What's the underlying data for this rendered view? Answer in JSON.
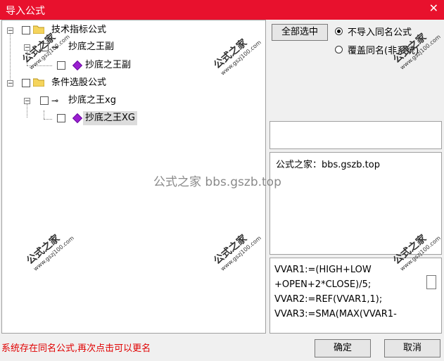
{
  "window": {
    "title": "导入公式",
    "close_label": "✕"
  },
  "tree": {
    "nodes": [
      {
        "label": "技术指标公式",
        "kind": "folder"
      },
      {
        "label": "抄底之王副",
        "kind": "key"
      },
      {
        "label": "抄底之王副",
        "kind": "gem"
      },
      {
        "label": "条件选股公式",
        "kind": "folder"
      },
      {
        "label": "抄底之王xg",
        "kind": "key"
      },
      {
        "label": "抄底之王XG",
        "kind": "gem",
        "selected": true
      }
    ]
  },
  "right": {
    "select_all": "全部选中",
    "radio_options": [
      {
        "label": "不导入同名公式",
        "checked": true
      },
      {
        "label": "覆盖同名(非系统)",
        "checked": false
      }
    ],
    "description": "公式之家：bbs.gszb.top",
    "code_lines": [
      "VVAR1:=(HIGH+LOW",
      "+OPEN+2*CLOSE)/5;",
      "VVAR2:=REF(VVAR1,1);",
      "VVAR3:=SMA(MAX(VVAR1-"
    ]
  },
  "status": "系统存在同名公式,再次点击可以更名",
  "buttons": {
    "ok": "确定",
    "cancel": "取消"
  },
  "watermark": {
    "main": "公式之家",
    "sub": "www.gszj100.com",
    "center": "公式之家 bbs.gszb.top"
  },
  "colors": {
    "titlebar": "#e8112d",
    "status": "#e00000",
    "gem": "#9b1fd1"
  }
}
